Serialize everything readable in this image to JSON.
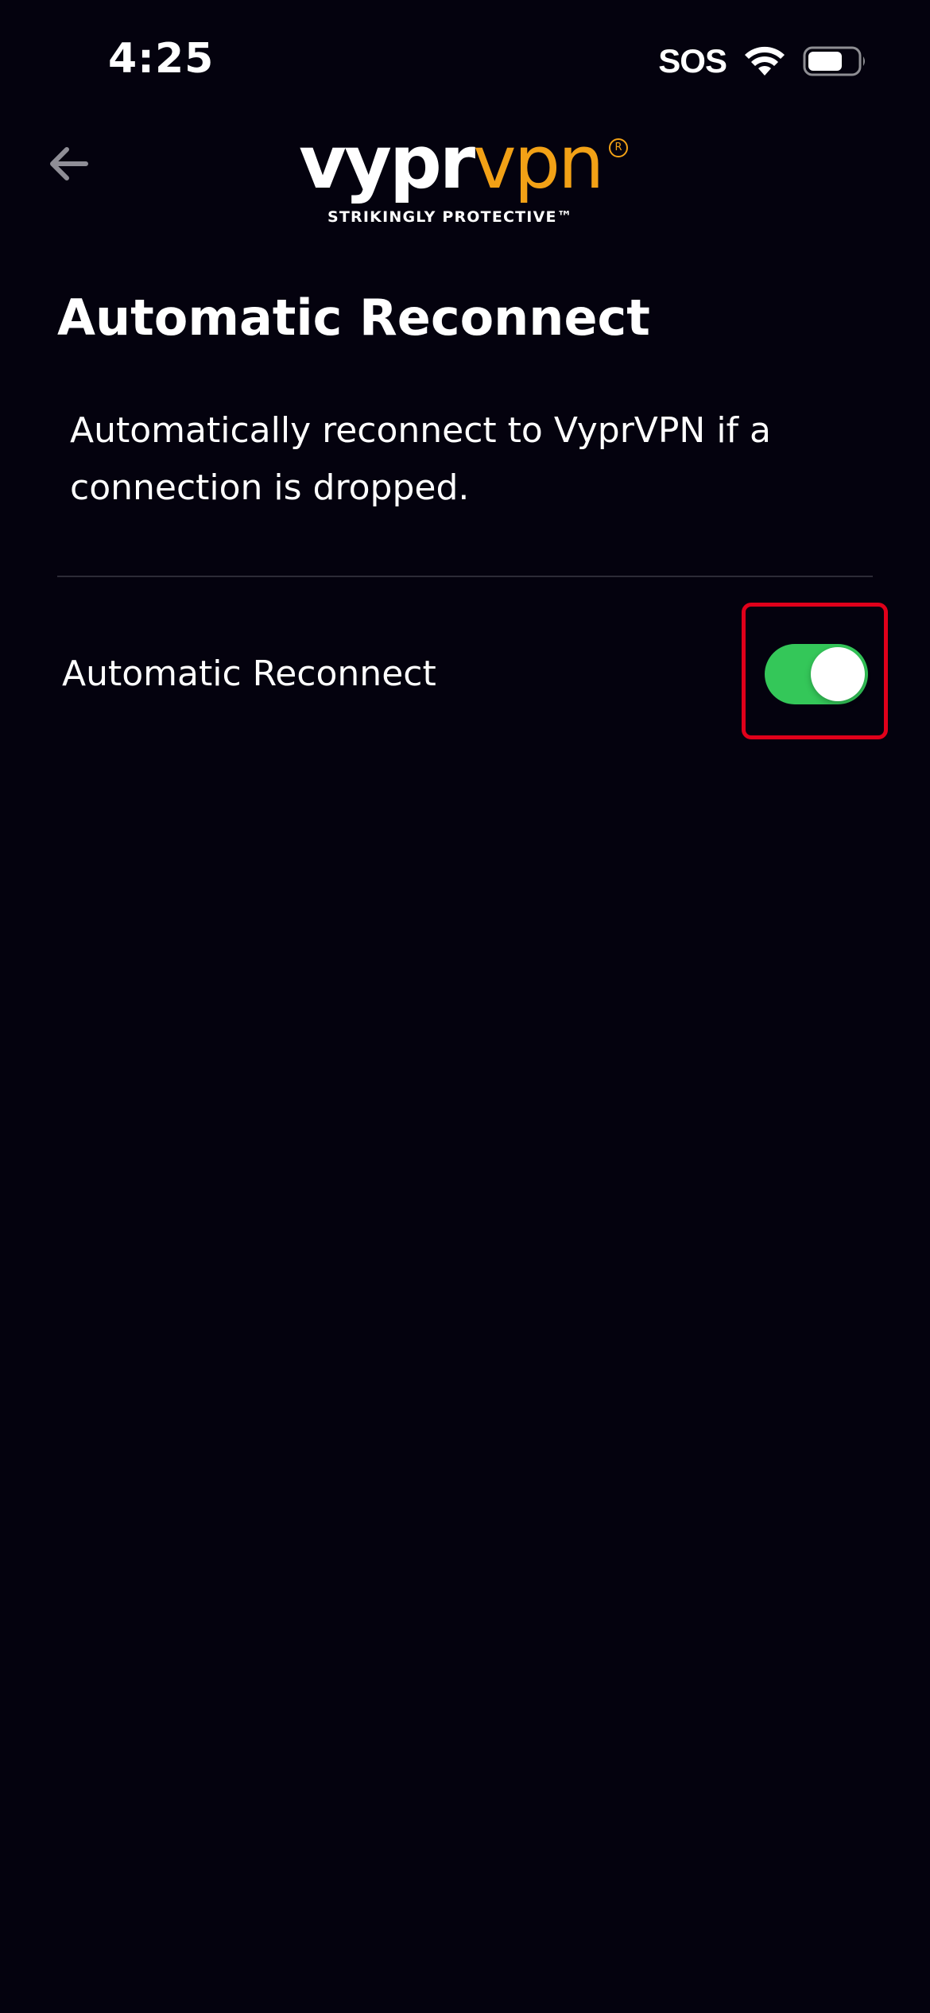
{
  "status_bar": {
    "time": "4:25",
    "carrier": "SOS",
    "wifi_icon": "wifi-icon",
    "battery_icon": "battery-icon"
  },
  "header": {
    "back_icon": "arrow-left-icon",
    "logo": {
      "word_primary": "vypr",
      "word_secondary": "vpn",
      "registered_mark": "R",
      "tagline": "STRIKINGLY PROTECTIVE™"
    }
  },
  "page": {
    "title": "Automatic Reconnect",
    "description": "Automatically reconnect to VyprVPN if a connection is dropped."
  },
  "settings": {
    "automatic_reconnect": {
      "label": "Automatic Reconnect",
      "enabled": true
    }
  },
  "colors": {
    "background": "#04020e",
    "brand_orange": "#f2a116",
    "toggle_on": "#34c759",
    "highlight": "#e0001a",
    "divider": "#2c2b36"
  }
}
